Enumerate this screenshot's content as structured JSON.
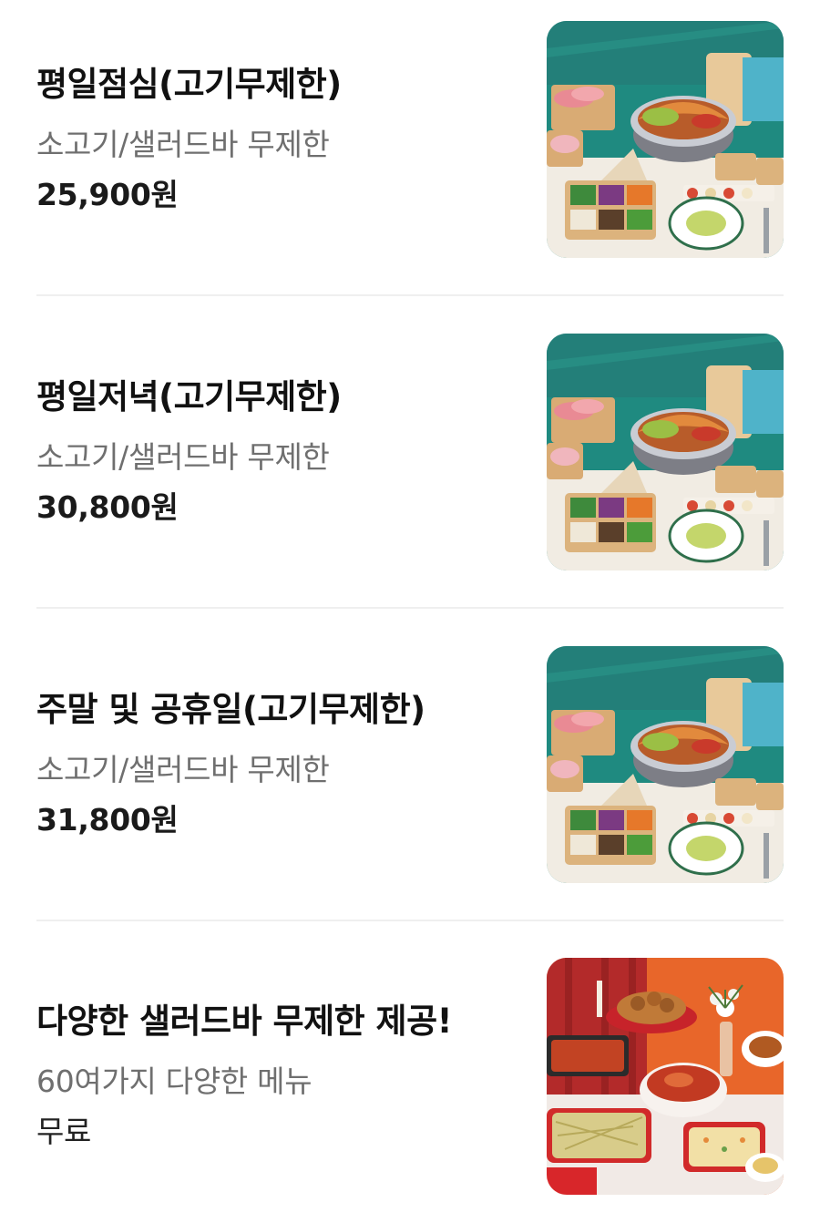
{
  "menu": {
    "items": [
      {
        "name": "평일점심(고기무제한)",
        "description": "소고기/샐러드바 무제한",
        "price": "25,900원",
        "image": "hotpot-buffet-photo"
      },
      {
        "name": "평일저녁(고기무제한)",
        "description": "소고기/샐러드바 무제한",
        "price": "30,800원",
        "image": "hotpot-buffet-photo"
      },
      {
        "name": "주말 및 공휴일(고기무제한)",
        "description": "소고기/샐러드바 무제한",
        "price": "31,800원",
        "image": "hotpot-buffet-photo"
      },
      {
        "name": "다양한 샐러드바 무제한 제공!",
        "description": "60여가지 다양한 메뉴",
        "price": "무료",
        "image": "salad-bar-photo"
      }
    ]
  },
  "colors": {
    "title": "#111111",
    "description": "#6f6f6f",
    "divider": "#efefef",
    "hotpot_background": "#1f8a80",
    "salad_background": "#e8662a"
  }
}
